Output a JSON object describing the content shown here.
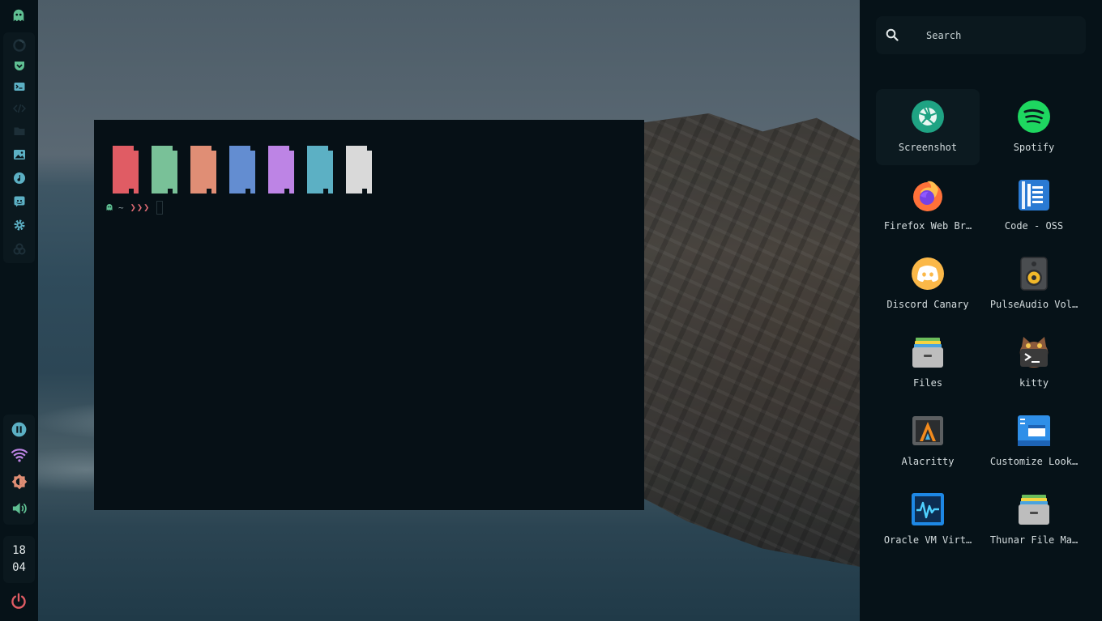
{
  "terminal": {
    "prompt_dir": "~",
    "prompt_arrows": "❯❯❯",
    "swatch_colors": [
      "#e05c64",
      "#79c198",
      "#e08e75",
      "#638dd1",
      "#bd84e5",
      "#5cb0c4",
      "#d9d9d9"
    ]
  },
  "clock": {
    "hour": "18",
    "minute": "04"
  },
  "leftbar": {
    "apps": [
      "firefox-icon",
      "pocket-icon",
      "terminal-icon",
      "code-icon",
      "folder-icon",
      "image-icon",
      "music-icon",
      "discord-icon",
      "settings-icon",
      "github-icon"
    ],
    "status": [
      "pause-icon",
      "wifi-icon",
      "brightness-icon",
      "volume-icon"
    ]
  },
  "launcher": {
    "search_placeholder": "Search",
    "apps": [
      {
        "label": "Screenshot",
        "icon": "screenshot-icon"
      },
      {
        "label": "Spotify",
        "icon": "spotify-icon"
      },
      {
        "label": "Firefox Web Br…",
        "icon": "firefox-icon"
      },
      {
        "label": "Code - OSS",
        "icon": "code-oss-icon"
      },
      {
        "label": "Discord Canary",
        "icon": "discord-canary-icon"
      },
      {
        "label": "PulseAudio Vol…",
        "icon": "speaker-icon"
      },
      {
        "label": "Files",
        "icon": "file-cabinet-icon"
      },
      {
        "label": "kitty",
        "icon": "kitty-icon"
      },
      {
        "label": "Alacritty",
        "icon": "alacritty-icon"
      },
      {
        "label": "Customize Look…",
        "icon": "window-settings-icon"
      },
      {
        "label": "Oracle VM Virt…",
        "icon": "virtualbox-icon"
      },
      {
        "label": "Thunar File Ma…",
        "icon": "file-cabinet-icon"
      }
    ]
  },
  "colors": {
    "accent_green": "#5fbf92",
    "power_red": "#e05c64",
    "wifi_purple": "#bd84e5",
    "brightness_orange": "#e08e75",
    "pause_cyan": "#5cb0c4"
  }
}
